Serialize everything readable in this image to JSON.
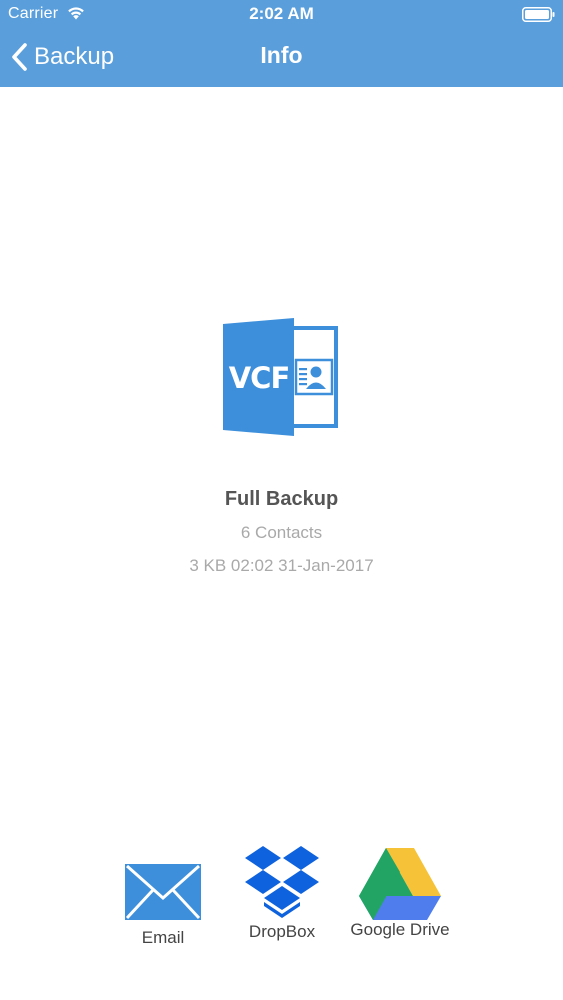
{
  "status_bar": {
    "carrier": "Carrier",
    "time": "2:02 AM"
  },
  "nav_bar": {
    "back_label": "Backup",
    "title": "Info"
  },
  "backup": {
    "icon_text": "VCF",
    "name": "Full Backup",
    "contacts": "6 Contacts",
    "meta": "3 KB 02:02 31-Jan-2017"
  },
  "share": {
    "email_label": "Email",
    "dropbox_label": "DropBox",
    "gdrive_label": "Google Drive"
  },
  "colors": {
    "nav_blue": "#5a9fdc",
    "vcf_blue": "#3d8fdb",
    "dropbox_blue": "#0f62dd",
    "gdrive_yellow": "#f6c338",
    "gdrive_green": "#22a564",
    "gdrive_blue": "#4f7ded"
  },
  "icons": [
    "wifi-icon",
    "battery-icon",
    "back-chevron-icon",
    "vcf-file-icon",
    "email-icon",
    "dropbox-icon",
    "google-drive-icon"
  ]
}
